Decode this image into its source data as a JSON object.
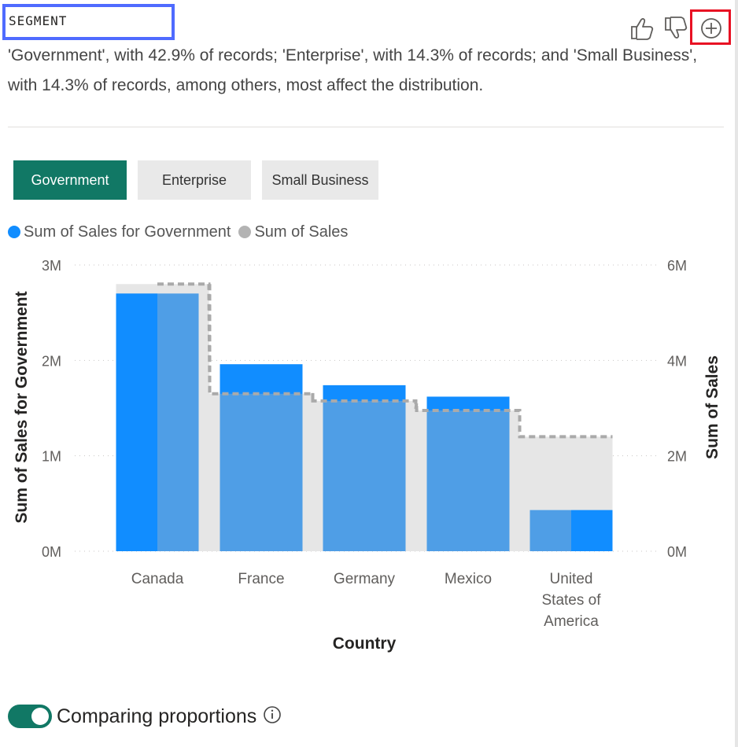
{
  "header": {
    "title": "SEGMENT"
  },
  "toolbar": {
    "icons": [
      "thumbs-up-icon",
      "thumbs-down-icon",
      "plus-circle-icon"
    ],
    "highlight_color": "#e81123"
  },
  "summary": {
    "text": "'Government', with 42.9% of records; 'Enterprise', with 14.3% of records; and 'Small Business', with 14.3% of records, among others, most affect the distribution."
  },
  "segments": [
    {
      "label": "Government",
      "active": true
    },
    {
      "label": "Enterprise",
      "active": false
    },
    {
      "label": "Small Business",
      "active": false
    }
  ],
  "legend": [
    {
      "label": "Sum of  Sales for Government",
      "color": "#118dff"
    },
    {
      "label": "Sum of  Sales",
      "color": "#b3b3b3"
    }
  ],
  "chart_data": {
    "type": "bar",
    "xlabel": "Country",
    "ylabel_left": "Sum of Sales for Government",
    "ylabel_right": "Sum of Sales",
    "categories": [
      "Canada",
      "France",
      "Germany",
      "Mexico",
      "United States of America"
    ],
    "category_label_lines": [
      [
        "Canada"
      ],
      [
        "France"
      ],
      [
        "Germany"
      ],
      [
        "Mexico"
      ],
      [
        "United",
        "States of",
        "America"
      ]
    ],
    "y_left": {
      "ticks": [
        "0M",
        "1M",
        "2M",
        "3M"
      ],
      "values": [
        0,
        1,
        2,
        3
      ],
      "range": [
        0,
        3
      ]
    },
    "y_right": {
      "ticks": [
        "0M",
        "2M",
        "4M",
        "6M"
      ],
      "values": [
        0,
        2,
        4,
        6
      ],
      "range": [
        0,
        6
      ]
    },
    "series": [
      {
        "name": "Sum of  Sales for Government",
        "axis": "left",
        "values": [
          2.7,
          1.96,
          1.74,
          1.62,
          0.43
        ],
        "color": "#118dff"
      },
      {
        "name": "Sum of  Sales",
        "axis": "right",
        "values": [
          5.6,
          3.3,
          3.15,
          2.95,
          2.4
        ],
        "color": "#b3b3b3"
      }
    ],
    "overlap_color": "#4f9ee6",
    "area_fill": "#e6e6e6",
    "grid": true
  },
  "footer": {
    "toggle_label": "Comparing proportions",
    "toggle_on": true,
    "toggle_color": "#117865"
  }
}
